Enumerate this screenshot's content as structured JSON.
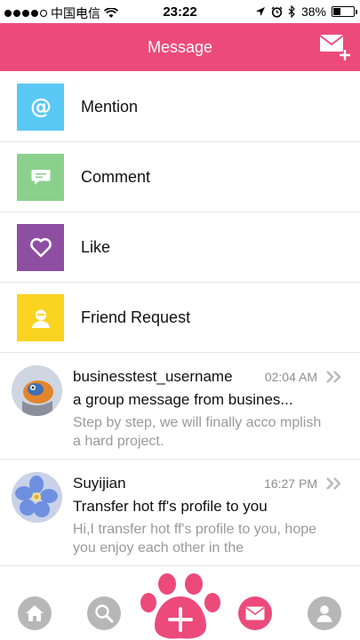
{
  "status_bar": {
    "carrier": "中国电信",
    "time": "23:22",
    "battery": "38%",
    "battery_level": 0.38,
    "signal_bars_filled": 4,
    "signal_bars_total": 5
  },
  "header": {
    "title": "Message",
    "compose_icon": "compose-mail-icon",
    "color": "#ec4a7a"
  },
  "categories": [
    {
      "label": "Mention",
      "icon": "at-icon",
      "color": "#5ac8f5"
    },
    {
      "label": "Comment",
      "icon": "comment-icon",
      "color": "#8cd08e"
    },
    {
      "label": "Like",
      "icon": "heart-icon",
      "color": "#8e4ea2"
    },
    {
      "label": "Friend Request",
      "icon": "person-icon",
      "color": "#fbd321"
    }
  ],
  "messages": [
    {
      "name": "businesstest_username",
      "time": "02:04 AM",
      "subject": "a group message from busines...",
      "preview": "Step by step, we will finally acco mplish a hard project."
    },
    {
      "name": "Suyijian",
      "time": "16:27 PM",
      "subject": "Transfer hot ff's profile to you",
      "preview": "Hi,I transfer hot ff's profile to you, hope you enjoy each other in the"
    }
  ],
  "tabbar": {
    "items": [
      {
        "icon": "home-icon"
      },
      {
        "icon": "search-icon"
      },
      {
        "icon": "paw-add-icon"
      },
      {
        "icon": "mail-icon"
      },
      {
        "icon": "profile-icon"
      }
    ]
  }
}
